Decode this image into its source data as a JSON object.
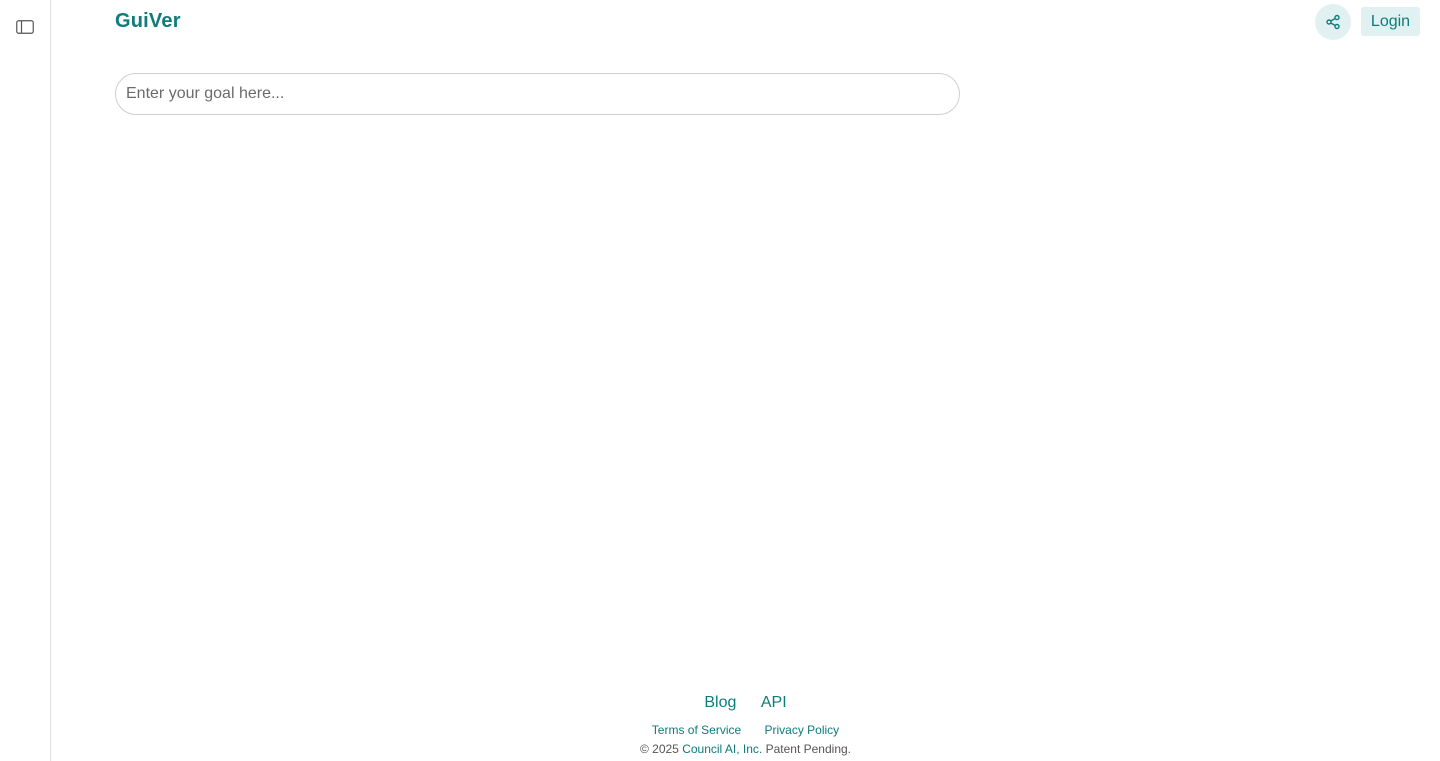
{
  "brand": {
    "name": "GuiVer",
    "color": "#0f7b7b"
  },
  "sidebar": {
    "toggle_icon": "sidebar-panel-icon"
  },
  "header": {
    "share_icon": "share-icon",
    "login_label": "Login"
  },
  "main": {
    "goal_placeholder": "Enter your goal here..."
  },
  "footer": {
    "links": [
      "Blog",
      "API"
    ],
    "legal": [
      "Terms of Service",
      "Privacy Policy"
    ],
    "copyright_prefix": "© 2025",
    "company": "Council AI, Inc.",
    "copyright_suffix": "Patent Pending."
  },
  "colors": {
    "accent": "#0f7b7b",
    "accent_bg": "#e1f1f1",
    "border": "#e2e2e2"
  }
}
